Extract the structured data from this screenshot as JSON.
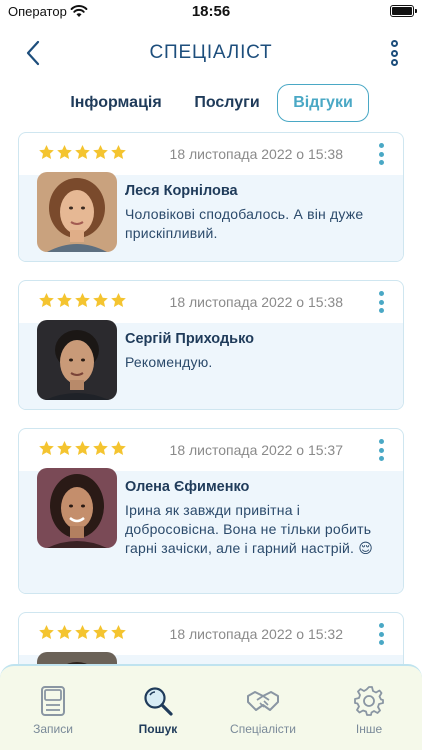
{
  "status_bar": {
    "carrier": "Оператор",
    "time": "18:56"
  },
  "header": {
    "title": "СПЕЦІАЛІСТ"
  },
  "tabs": [
    {
      "label": "Інформація",
      "active": false
    },
    {
      "label": "Послуги",
      "active": false
    },
    {
      "label": "Відгуки",
      "active": true
    }
  ],
  "reviews": [
    {
      "rating": 5,
      "date": "18 листопада 2022 о 15:38",
      "author": "Леся Корнілова",
      "text": "Чоловікові сподобалось. А він дуже прискіпливий."
    },
    {
      "rating": 5,
      "date": "18 листопада 2022 о 15:38",
      "author": "Сергій Приходько",
      "text": "Рекомендую."
    },
    {
      "rating": 5,
      "date": "18 листопада 2022 о 15:37",
      "author": "Олена Єфименко",
      "text": "Ірина як завжди привітна і добросовісна. Вона не тільки робить гарні зачіски, але і гарний настрій. 😌"
    },
    {
      "rating": 5,
      "date": "18 листопада 2022 о 15:32",
      "author": "",
      "text": ""
    }
  ],
  "tabbar": [
    {
      "label": "Записи",
      "icon": "document-icon",
      "active": false
    },
    {
      "label": "Пошук",
      "icon": "search-icon",
      "active": true
    },
    {
      "label": "Спеціалісти",
      "icon": "handshake-icon",
      "active": false
    },
    {
      "label": "Інше",
      "icon": "gear-icon",
      "active": false
    }
  ],
  "colors": {
    "accent": "#4aa8c5",
    "primary_text": "#1f3b5a",
    "star": "#f4c430",
    "card_body": "#eef6fc",
    "tabbar_bg": "#f5f9ea"
  }
}
